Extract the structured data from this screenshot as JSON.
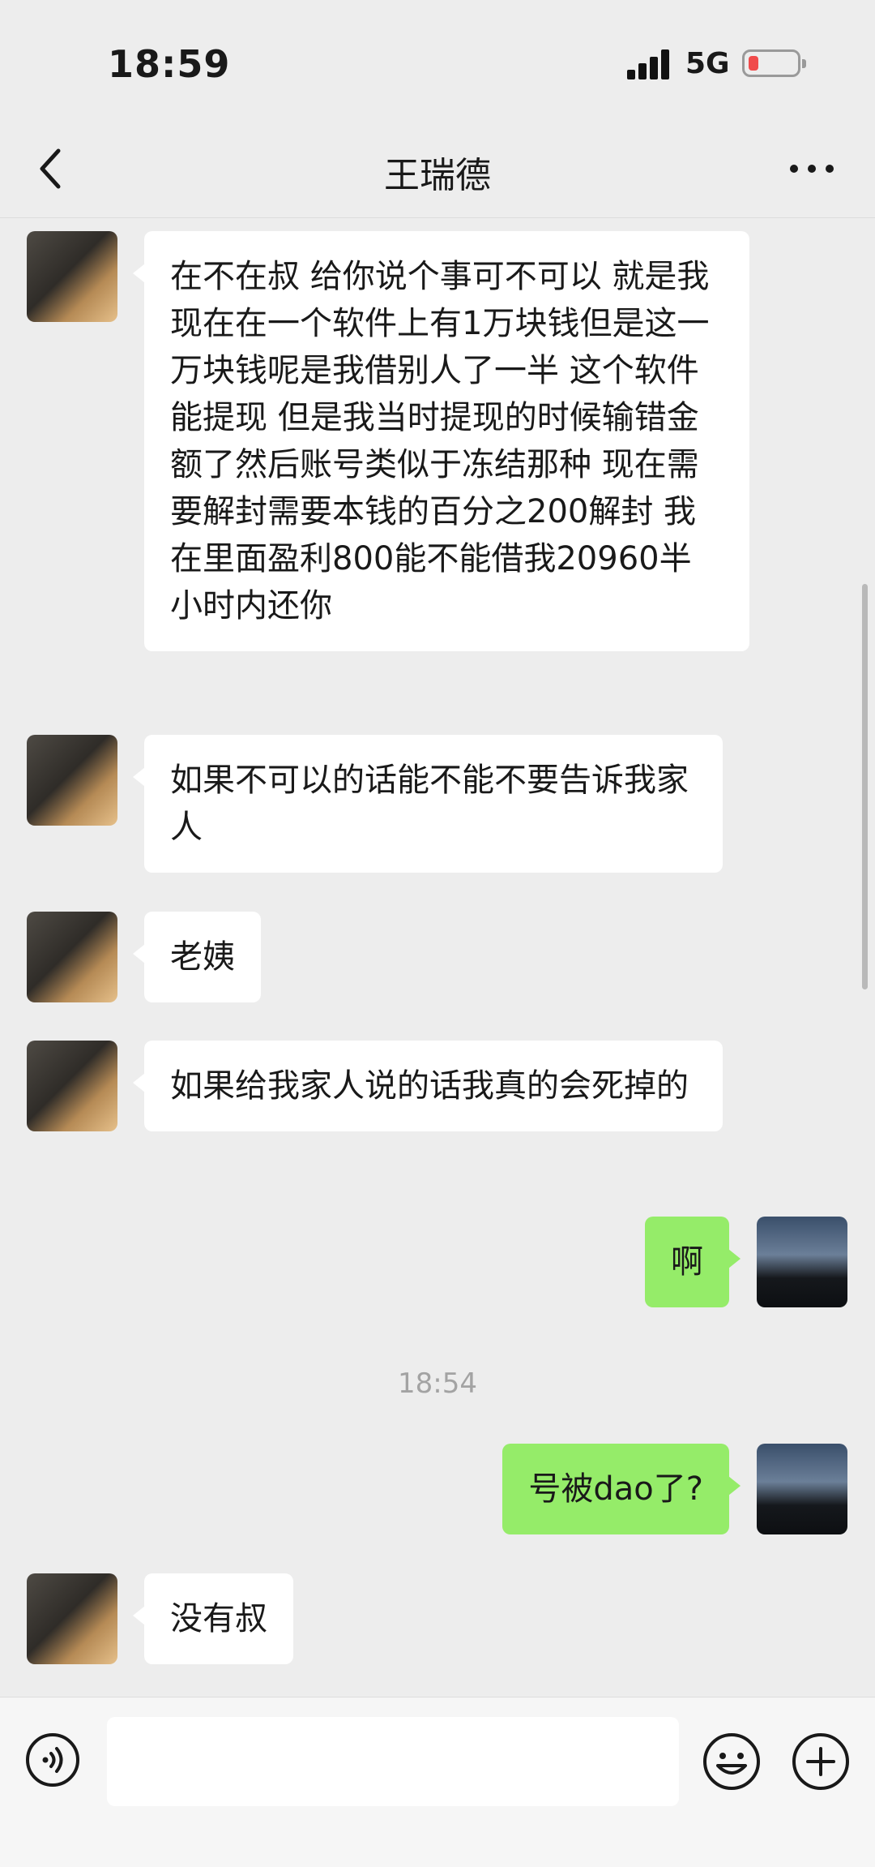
{
  "status_bar": {
    "time": "18:59",
    "network": "5G",
    "battery_percent": 10
  },
  "nav": {
    "title": "王瑞德",
    "back_icon": "chevron-left-icon",
    "more_icon": "more-dots-icon"
  },
  "messages": [
    {
      "sender": "contact",
      "text": "在不在叔 给你说个事可不可以 就是我现在在一个软件上有1万块钱但是这一万块钱呢是我借别人了一半 这个软件能提现 但是我当时提现的时候输错金额了然后账号类似于冻结那种 现在需要解封需要本钱的百分之200解封 我在里面盈利800能不能借我20960半小时内还你"
    },
    {
      "sender": "contact",
      "text": "如果不可以的话能不能不要告诉我家人"
    },
    {
      "sender": "contact",
      "text": "老姨"
    },
    {
      "sender": "contact",
      "text": "如果给我家人说的话我真的会死掉的"
    },
    {
      "sender": "self",
      "text": "啊"
    },
    {
      "sender": "self",
      "text": "号被dao了?"
    },
    {
      "sender": "contact",
      "text": "没有叔"
    }
  ],
  "timestamp": "18:54",
  "input_bar": {
    "placeholder": "",
    "voice_icon": "voice-icon",
    "emoji_icon": "emoji-icon",
    "plus_icon": "plus-icon"
  },
  "colors": {
    "background": "#ededed",
    "bubble_in": "#ffffff",
    "bubble_out": "#95ec69",
    "battery_low": "#f04b4b"
  }
}
